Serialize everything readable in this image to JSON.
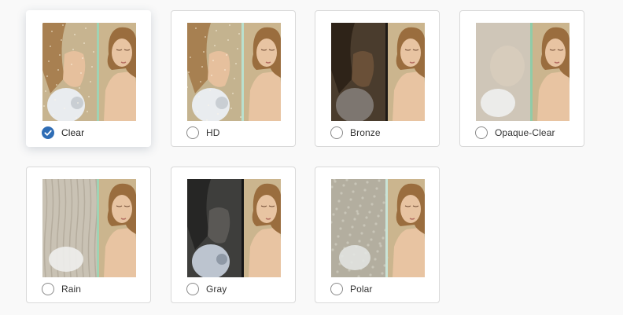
{
  "glass_options": [
    {
      "label": "Clear",
      "selected": true,
      "style": "clear",
      "glass_color": "#c7b490",
      "divider": "#9fd3b4"
    },
    {
      "label": "HD",
      "selected": false,
      "style": "clear",
      "glass_color": "#c4b38f",
      "divider": "#b9e0ce"
    },
    {
      "label": "Bronze",
      "selected": false,
      "style": "tint",
      "glass_color": "#4a3c2d",
      "divider": "#1e1a16"
    },
    {
      "label": "Opaque-Clear",
      "selected": false,
      "style": "frost",
      "glass_color": "#cfc6b8",
      "divider": "#8fcca8"
    },
    {
      "label": "Rain",
      "selected": false,
      "style": "rain",
      "glass_color": "#c9c2b4",
      "divider": "#9fd3b4"
    },
    {
      "label": "Gray",
      "selected": false,
      "style": "gray",
      "glass_color": "#3e3e3c",
      "divider": "#161616"
    },
    {
      "label": "Polar",
      "selected": false,
      "style": "polar",
      "glass_color": "#b3ae9f",
      "divider": "#c9e3d6"
    }
  ],
  "colors": {
    "accent": "#2f6db5",
    "card_border": "#d9d9d9",
    "page_background": "#f9f9f9",
    "label_text": "#333333",
    "wall_background": "#cbb58e",
    "skin": "#e8c4a2",
    "hair": "#9a6d3e"
  },
  "icons": {
    "selected_indicator": "check-circle-icon",
    "unselected_indicator": "radio-empty-icon"
  }
}
